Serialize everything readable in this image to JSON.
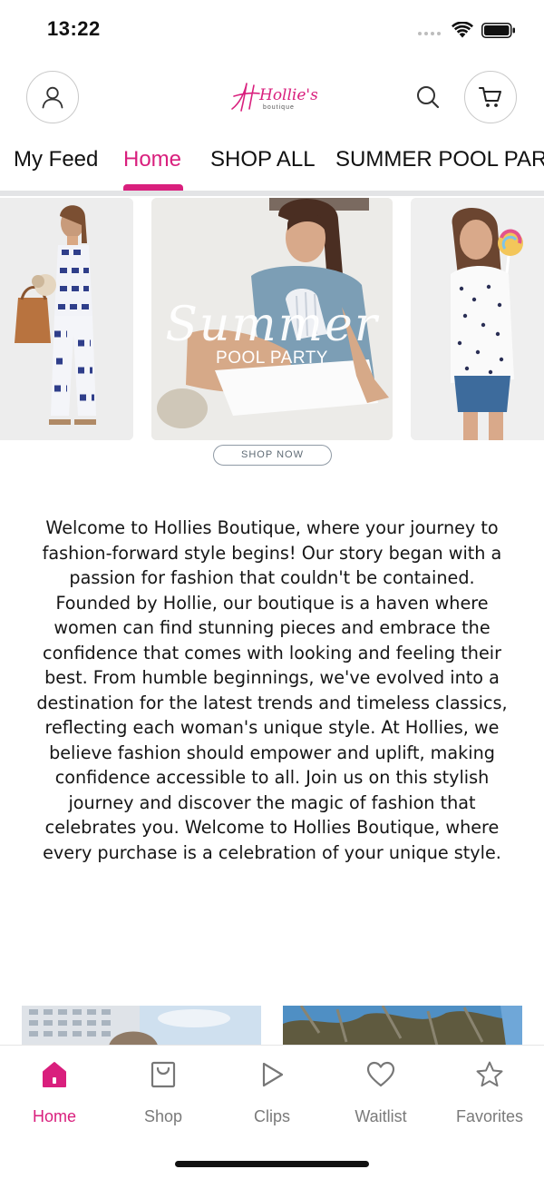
{
  "status_bar": {
    "time": "13:22"
  },
  "header": {
    "logo_text": "Hollie's",
    "logo_sub": "boutique",
    "account_icon": "user-icon",
    "search_icon": "search-icon",
    "cart_icon": "cart-icon"
  },
  "tabs": [
    {
      "label": "My Feed",
      "active": false
    },
    {
      "label": "Home",
      "active": true
    },
    {
      "label": "SHOP ALL",
      "active": false
    },
    {
      "label": "SUMMER POOL PARTY",
      "active": false
    }
  ],
  "carousel": {
    "overlay_script": "Summer",
    "overlay_title": "POOL PARTY",
    "shop_now_label": "SHOP NOW"
  },
  "welcome_text": "Welcome to Hollies Boutique, where your journey to fashion-forward style begins! Our story began with a passion for fashion that couldn't be contained. Founded by Hollie, our boutique is a haven where women can find stunning pieces and embrace the confidence that comes with looking and feeling their best. From humble beginnings, we've evolved into a destination for the latest trends and timeless classics, reflecting each woman's unique style. At Hollies, we believe fashion should empower and uplift, making confidence accessible to all. Join us on this stylish journey and discover the magic of fashion that celebrates you. Welcome to Hollies Boutique, where every purchase is a celebration of your unique style.",
  "bottom_nav": [
    {
      "label": "Home",
      "icon": "home-icon",
      "active": true
    },
    {
      "label": "Shop",
      "icon": "shopping-bag-icon",
      "active": false
    },
    {
      "label": "Clips",
      "icon": "play-icon",
      "active": false
    },
    {
      "label": "Waitlist",
      "icon": "heart-icon",
      "active": false
    },
    {
      "label": "Favorites",
      "icon": "star-icon",
      "active": false
    }
  ],
  "colors": {
    "accent": "#d91f7d",
    "inactive_nav": "#7a7a7a",
    "text": "#151515"
  }
}
